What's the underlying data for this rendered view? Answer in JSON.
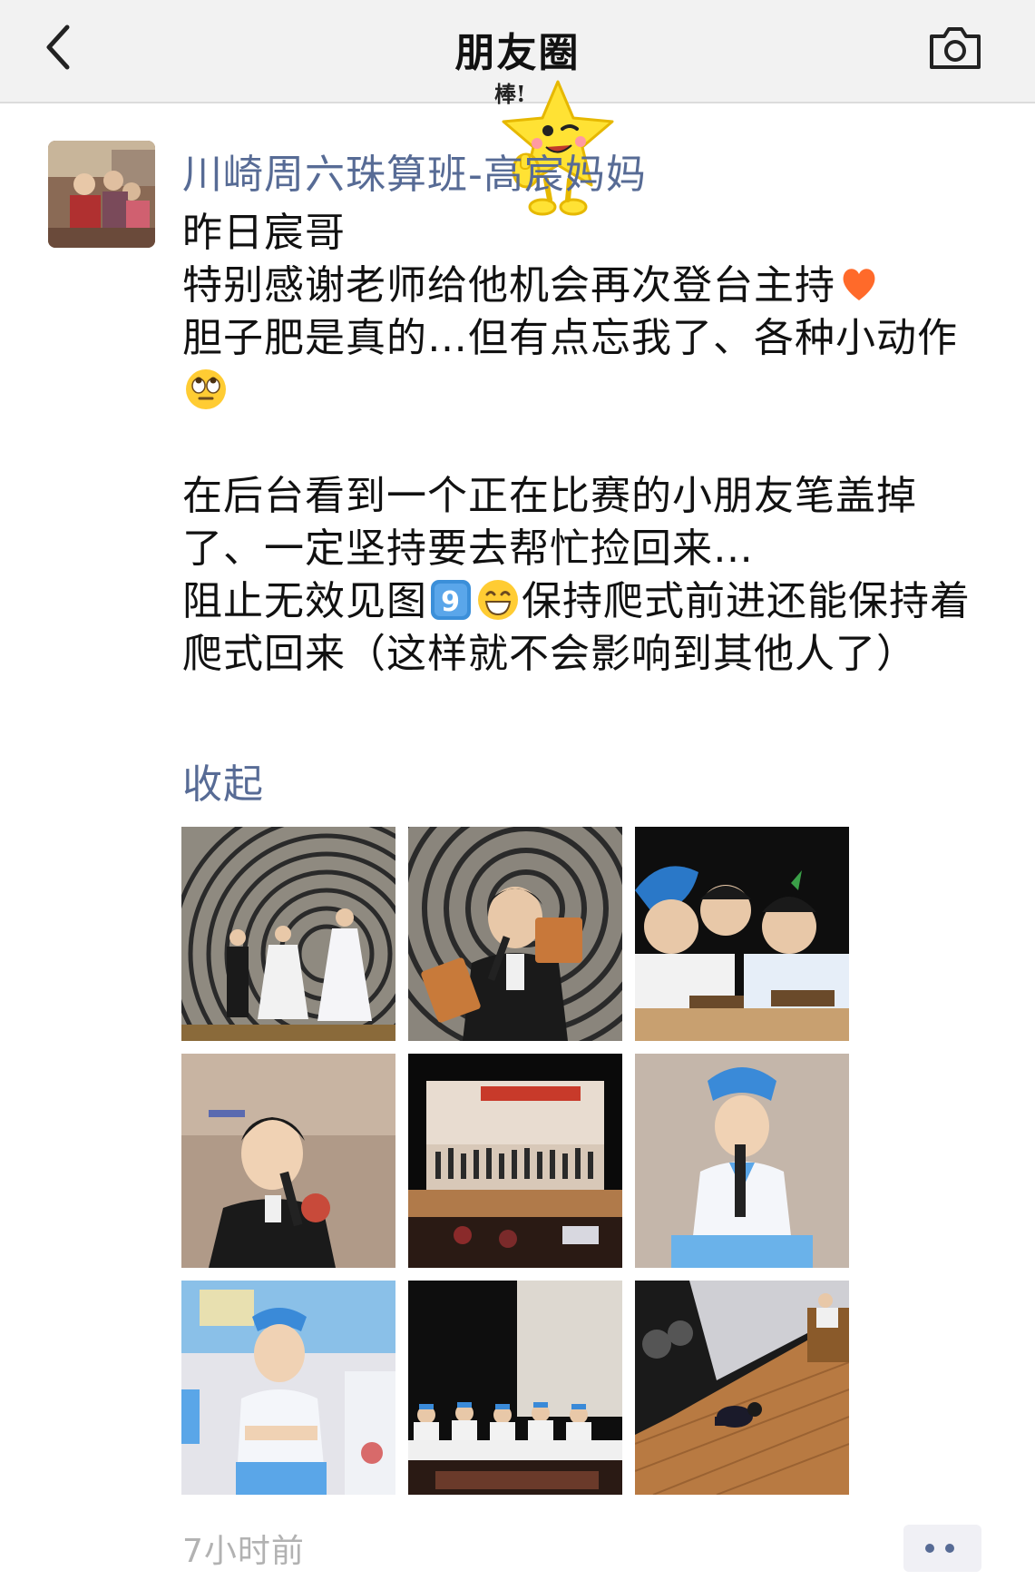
{
  "nav": {
    "back_icon": "chevron-left-icon",
    "title": "朋友圈",
    "camera_icon": "camera-icon"
  },
  "post": {
    "author": "川崎周六珠算班-高宸妈妈",
    "text_lines": {
      "l1": "昨日宸哥",
      "l2": "特别感谢老师给他机会再次登台主持",
      "l3": "胆子肥是真的…但有点忘我了、各种小动作",
      "l4": "在后台看到一个正在比赛的小朋友笔盖掉了、一定坚持要去帮忙捡回来…",
      "l5a": "阻止无效见图",
      "l5b": "保持爬式前进还能保持着爬式回来（这样就不会影响到其他人了）"
    },
    "emojis": {
      "heart": "orange-heart-emoji",
      "eyeroll": "eye-roll-emoji",
      "nine": "keycap-nine-emoji",
      "grin": "grinning-emoji"
    },
    "collapse_label": "收起",
    "photo_count": 9,
    "timestamp": "7小时前",
    "more_icon": "more-dots-icon"
  },
  "sticker": {
    "caption": "棒!",
    "icon": "thumbs-up-star-sticker"
  },
  "colors": {
    "link": "#576b95",
    "nav_bg": "#f2f2f2",
    "timestamp": "#b2b2b2"
  }
}
